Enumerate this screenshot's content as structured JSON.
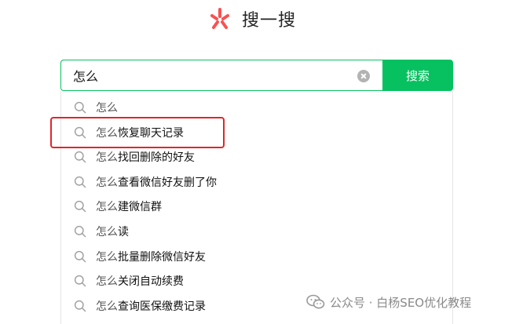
{
  "logo": {
    "icon": "sou-yi-sou-logo-icon",
    "title": "搜一搜",
    "brand_color": "#fa5151"
  },
  "search": {
    "query": "怎么",
    "clear_icon": "clear-icon",
    "button_label": "搜索",
    "accent_color": "#07c160"
  },
  "suggestions": [
    {
      "prefix": "怎么",
      "rest": ""
    },
    {
      "prefix": "怎么",
      "rest": "恢复聊天记录",
      "highlighted": true
    },
    {
      "prefix": "怎么",
      "rest": "找回删除的好友"
    },
    {
      "prefix": "怎么",
      "rest": "查看微信好友删了你"
    },
    {
      "prefix": "怎么",
      "rest": "建微信群"
    },
    {
      "prefix": "怎么",
      "rest": "读"
    },
    {
      "prefix": "怎么",
      "rest": "批量删除微信好友"
    },
    {
      "prefix": "怎么",
      "rest": "关闭自动续费"
    },
    {
      "prefix": "怎么",
      "rest": "查询医保缴费记录"
    }
  ],
  "annotation": {
    "highlight_color": "#e0262b"
  },
  "watermark": {
    "icon": "wechat-icon",
    "text": "公众号 · 白杨SEO优化教程"
  }
}
